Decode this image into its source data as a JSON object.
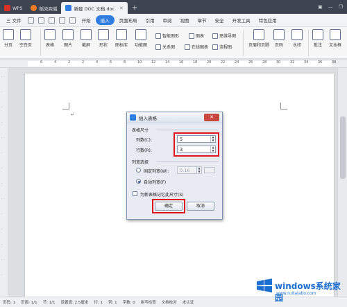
{
  "tabs": {
    "wps": "WPS",
    "store": "稻壳商城",
    "doc": "新建 DOC 文档.doc"
  },
  "menu": {
    "file": "三 文件",
    "items": [
      "开始",
      "插入",
      "页面布局",
      "引用",
      "审阅",
      "视图",
      "章节",
      "安全",
      "开发工具",
      "特色应用"
    ]
  },
  "ribbon": {
    "page_break": "分页",
    "blank_page": "空白页",
    "table": "表格",
    "picture": "图片",
    "screenshot": "截屏",
    "shape": "形状",
    "icon_lib": "图标库",
    "func_chart": "功能图",
    "smart_shape": "智能图形",
    "chart": "图表",
    "mindmap": "思维导图",
    "online_chart": "在线图表",
    "flowchart": "流程图",
    "relation": "关系图",
    "header_footer": "页眉和页脚",
    "page_num": "页码",
    "watermark": "水印",
    "comment": "批注",
    "textbox": "文本框"
  },
  "ruler": [
    "6",
    "4",
    "2",
    "2",
    "4",
    "6",
    "8",
    "10",
    "12",
    "14",
    "16",
    "18",
    "20",
    "22",
    "24",
    "26",
    "28",
    "30",
    "32",
    "34",
    "36",
    "38"
  ],
  "dialog": {
    "title": "插入表格",
    "size_section": "表格尺寸",
    "cols_label": "列数(C):",
    "cols_value": "5",
    "rows_label": "行数(R):",
    "rows_value": "3",
    "width_section": "列宽选择",
    "fixed_label": "固定列宽(W):",
    "fixed_value": "0.16",
    "auto_label": "自动列宽(F)",
    "remember_label": "为新表格记忆此尺寸(S)",
    "ok": "确定",
    "cancel": "取消"
  },
  "status": {
    "page": "页码: 1",
    "pages": "页面: 1/1",
    "section": "节: 1/1",
    "setting": "设置值: 2.5厘米",
    "row": "行: 1",
    "col": "列: 1",
    "words": "字数: 0",
    "spell": "拼写检查",
    "proof": "文档校对",
    "auth": "未认证"
  },
  "watermark": {
    "brand": "windows系统家园",
    "url": "www.ruitaiabo.com"
  },
  "colors": {
    "accent": "#2f7de1",
    "highlight": "#e0141e",
    "tabbar": "#3d4350"
  }
}
